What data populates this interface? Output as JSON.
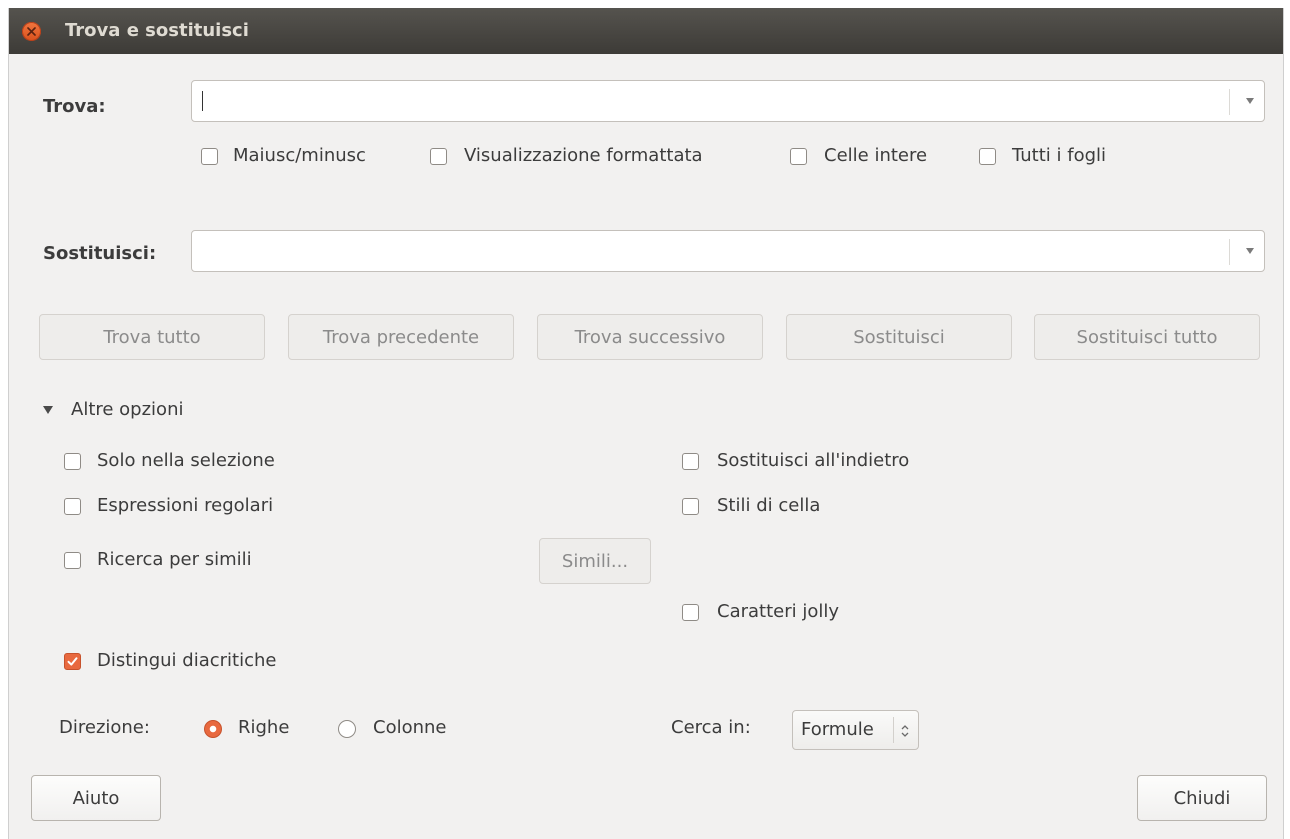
{
  "window": {
    "title": "Trova e sostituisci"
  },
  "find": {
    "label": "Trova:",
    "value": ""
  },
  "find_options": [
    {
      "label": "Maiusc/minusc",
      "checked": false
    },
    {
      "label": "Visualizzazione formattata",
      "checked": false
    },
    {
      "label": "Celle intere",
      "checked": false
    },
    {
      "label": "Tutti i fogli",
      "checked": false
    }
  ],
  "replace": {
    "label": "Sostituisci:",
    "value": ""
  },
  "actions": [
    {
      "label": "Trova tutto",
      "enabled": false
    },
    {
      "label": "Trova precedente",
      "enabled": false
    },
    {
      "label": "Trova successivo",
      "enabled": false
    },
    {
      "label": "Sostituisci",
      "enabled": false
    },
    {
      "label": "Sostituisci tutto",
      "enabled": false
    }
  ],
  "more_options": {
    "label": "Altre opzioni",
    "expanded": true,
    "left": [
      {
        "label": "Solo nella selezione",
        "checked": false
      },
      {
        "label": "Espressioni regolari",
        "checked": false
      },
      {
        "label": "Ricerca per simili",
        "checked": false
      }
    ],
    "similar_button": "Simili...",
    "right": [
      {
        "label": "Sostituisci all'indietro",
        "checked": false
      },
      {
        "label": "Stili di cella",
        "checked": false
      },
      {
        "label": "Caratteri jolly",
        "checked": false
      }
    ],
    "diacritics": {
      "label": "Distingui diacritiche",
      "checked": true
    }
  },
  "direction": {
    "label": "Direzione:",
    "options": [
      {
        "label": "Righe",
        "selected": true
      },
      {
        "label": "Colonne",
        "selected": false
      }
    ]
  },
  "search_in": {
    "label": "Cerca in:",
    "value": "Formule"
  },
  "footer": {
    "help": "Aiuto",
    "close": "Chiudi"
  },
  "colors": {
    "accent": "#e8693f",
    "titlebar": "#3d3b37",
    "background": "#f2f1f0"
  }
}
